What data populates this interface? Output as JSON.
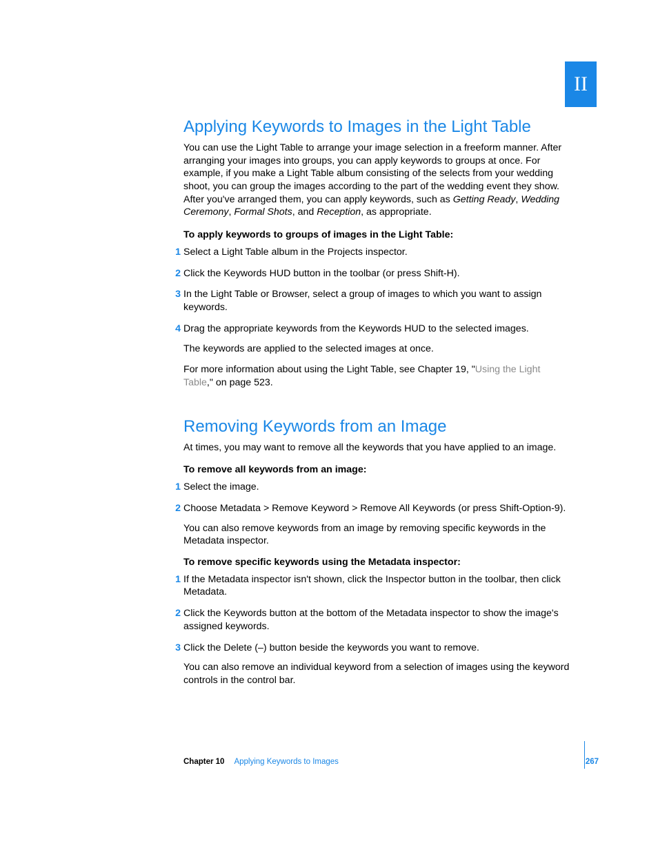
{
  "part_label": "II",
  "section1": {
    "heading": "Applying Keywords to Images in the Light Table",
    "intro_pre": "You can use the Light Table to arrange your image selection in a freeform manner. After arranging your images into groups, you can apply keywords to groups at once. For example, if you make a Light Table album consisting of the selects from your wedding shoot, you can group the images according to the part of the wedding event they show. After you've arranged them, you can apply keywords, such as ",
    "kw1": "Getting Ready",
    "sep1": ", ",
    "kw2": "Wedding Ceremony",
    "sep2": ", ",
    "kw3": "Formal Shots",
    "sep3": ", and ",
    "kw4": "Reception",
    "intro_post": ", as appropriate.",
    "lead": "To apply keywords to groups of images in the Light Table:",
    "steps": [
      "Select a Light Table album in the Projects inspector.",
      "Click the Keywords HUD button in the toolbar (or press Shift-H).",
      "In the Light Table or Browser, select a group of images to which you want to assign keywords.",
      "Drag the appropriate keywords from the Keywords HUD to the selected images."
    ],
    "after1": "The keywords are applied to the selected images at once.",
    "after2_pre": "For more information about using the Light Table, see Chapter 19, \"",
    "after2_link": "Using the Light Table",
    "after2_post": ",\" on page 523."
  },
  "section2": {
    "heading": "Removing Keywords from an Image",
    "intro": "At times, you may want to remove all the keywords that you have applied to an image.",
    "leadA": "To remove all keywords from an image:",
    "stepsA": [
      "Select the image.",
      "Choose Metadata > Remove Keyword > Remove All Keywords (or press Shift-Option-9)."
    ],
    "afterA": "You can also remove keywords from an image by removing specific keywords in the Metadata inspector.",
    "leadB": "To remove specific keywords using the Metadata inspector:",
    "stepsB": [
      "If the Metadata inspector isn't shown, click the Inspector button in the toolbar, then click Metadata.",
      "Click the Keywords button at the bottom of the Metadata inspector to show the image's assigned keywords.",
      "Click the Delete (–) button beside the keywords you want to remove."
    ],
    "afterB": "You can also remove an individual keyword from a selection of images using the keyword controls in the control bar."
  },
  "footer": {
    "chapter": "Chapter 10",
    "name": "Applying Keywords to Images",
    "page": "267"
  }
}
